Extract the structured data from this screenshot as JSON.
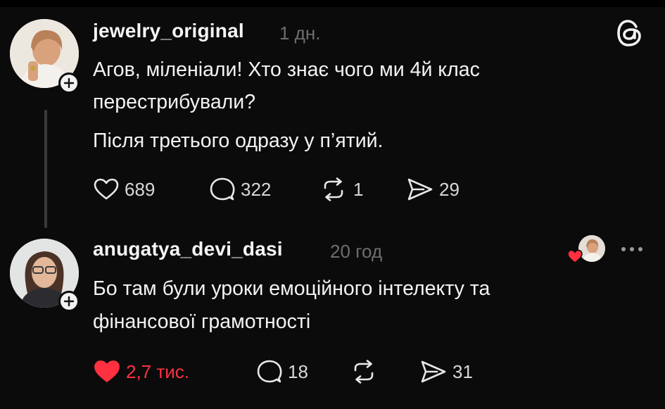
{
  "colors": {
    "background": "#0b0b0b",
    "text": "#f3f3f3",
    "muted": "#6e6e6e",
    "like_red": "#ff3040",
    "thread_line": "#3a3a3a"
  },
  "app_icon": "threads-logo-icon",
  "posts": [
    {
      "username": "jewelry_original",
      "time": "1 дн.",
      "lines": [
        "Агов, міленіали! Хто знає чого ми 4й клас",
        "перестрибували?",
        "Після третього одразу у п’ятий."
      ],
      "likes": "689",
      "replies": "322",
      "reposts": "1",
      "shares": "29",
      "liked": false
    },
    {
      "username": "anugatya_devi_dasi",
      "time": "20 год",
      "lines": [
        "Бо там були уроки емоційного інтелекту та",
        "фінансової грамотності"
      ],
      "likes": "2,7 тис.",
      "replies": "18",
      "reposts": "",
      "shares": "31",
      "liked": true,
      "liked_by_author_icon": "heart-icon"
    }
  ]
}
